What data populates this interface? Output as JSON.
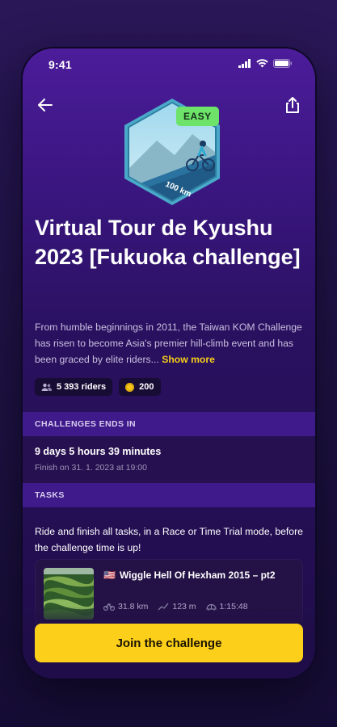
{
  "status": {
    "time": "9:41"
  },
  "challenge": {
    "difficulty": "EASY",
    "badge_label": "100 km",
    "title": "Virtual Tour de Kyushu 2023 [Fukuoka challenge]",
    "description": "From humble beginnings in 2011, the Taiwan KOM Challenge has risen to become Asia's premier hill-climb event and has been graced by elite riders...",
    "show_more": "Show more",
    "riders": "5 393 riders",
    "points": "200"
  },
  "ends": {
    "header": "CHALLENGES ENDS IN",
    "remaining": "9 days 5 hours 39 minutes",
    "finish": "Finish on 31. 1. 2023 at 19:00"
  },
  "tasks": {
    "header": "TASKS",
    "instructions": "Ride and finish all tasks, in a Race or Time Trial mode, before the challenge time is up!",
    "items": [
      {
        "flag": "🇺🇸",
        "name": "Wiggle Hell Of Hexham 2015 – pt2",
        "distance": "31.8 km",
        "elevation": "123 m",
        "duration": "1:15:48"
      }
    ]
  },
  "cta": {
    "label": "Join the challenge"
  },
  "colors": {
    "accent": "#fccf1a",
    "easy": "#6ee36a",
    "bg": "#2a1160"
  }
}
